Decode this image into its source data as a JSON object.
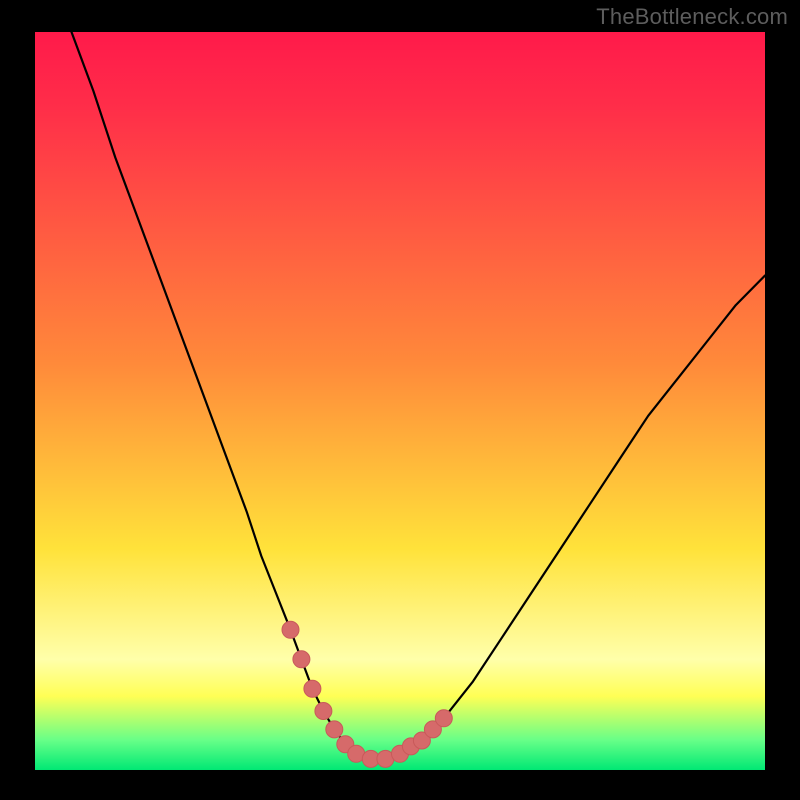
{
  "watermark": "TheBottleneck.com",
  "colors": {
    "grad_top": "#ff1a4a",
    "grad_mid_red": "#ff2d49",
    "grad_orange": "#ff8a3a",
    "grad_yellow": "#ffe23a",
    "grad_pale_yellow": "#ffffaa",
    "grad_bright_yellow": "#ffff55",
    "grad_green_light": "#66ff88",
    "grad_green": "#00e874",
    "curve_stroke": "#000000",
    "marker_fill": "#d66a6a",
    "marker_stroke": "#c85a5a",
    "frame_bg": "#000000"
  },
  "chart_data": {
    "type": "line",
    "title": "",
    "xlabel": "",
    "ylabel": "",
    "xlim": [
      0,
      100
    ],
    "ylim": [
      0,
      100
    ],
    "grid": false,
    "legend": false,
    "series": [
      {
        "name": "bottleneck-curve",
        "x": [
          5,
          8,
          11,
          14,
          17,
          20,
          23,
          26,
          29,
          31,
          33,
          35,
          36.5,
          38,
          39.5,
          41,
          42.5,
          44,
          46,
          48,
          50,
          53,
          56,
          60,
          64,
          68,
          72,
          76,
          80,
          84,
          88,
          92,
          96,
          100
        ],
        "y": [
          100,
          92,
          83,
          75,
          67,
          59,
          51,
          43,
          35,
          29,
          24,
          19,
          15,
          11,
          8,
          5.5,
          3.5,
          2.2,
          1.5,
          1.5,
          2.2,
          4,
          7,
          12,
          18,
          24,
          30,
          36,
          42,
          48,
          53,
          58,
          63,
          67
        ]
      }
    ],
    "markers": {
      "name": "highlight-points",
      "points": [
        {
          "x": 35,
          "y": 19
        },
        {
          "x": 36.5,
          "y": 15
        },
        {
          "x": 38,
          "y": 11
        },
        {
          "x": 39.5,
          "y": 8
        },
        {
          "x": 41,
          "y": 5.5
        },
        {
          "x": 42.5,
          "y": 3.5
        },
        {
          "x": 44,
          "y": 2.2
        },
        {
          "x": 46,
          "y": 1.5
        },
        {
          "x": 48,
          "y": 1.5
        },
        {
          "x": 50,
          "y": 2.2
        },
        {
          "x": 51.5,
          "y": 3.2
        },
        {
          "x": 53,
          "y": 4
        },
        {
          "x": 54.5,
          "y": 5.5
        },
        {
          "x": 56,
          "y": 7
        }
      ]
    }
  }
}
